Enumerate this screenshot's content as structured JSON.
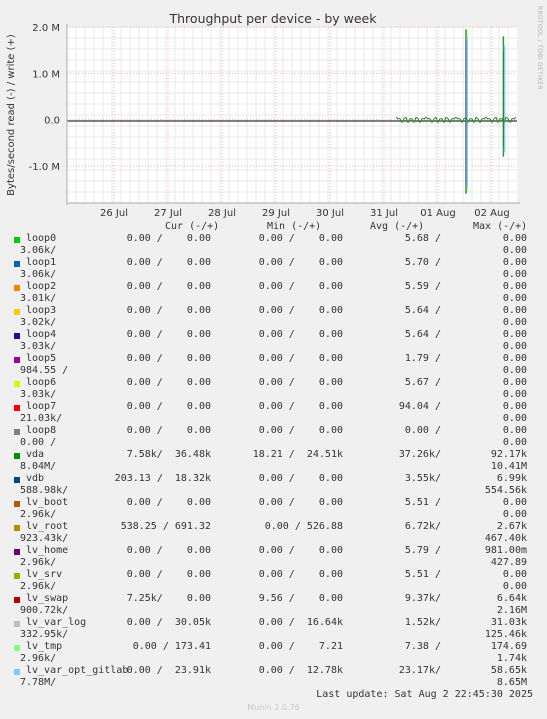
{
  "chart_data": {
    "type": "line",
    "title": "Throughput per device - by week",
    "ylabel": "Bytes/second read (-) / write (+)",
    "ylim": [
      -1800000,
      2000000
    ],
    "yticks": [
      "2.0 M",
      "1.0 M",
      "0.0",
      "-1.0 M"
    ],
    "xticks": [
      "26 Jul",
      "27 Jul",
      "28 Jul",
      "29 Jul",
      "30 Jul",
      "31 Jul",
      "01 Aug",
      "02 Aug"
    ],
    "grid": true,
    "series": [
      {
        "name": "vda",
        "color": "#00b300",
        "points": [
          [
            0.92,
            1800000
          ],
          [
            0.92,
            -800000
          ],
          [
            1.0,
            1950000
          ],
          [
            1.0,
            -1600000
          ]
        ]
      },
      {
        "name": "vdb",
        "color": "#0b5790",
        "points": [
          [
            0.92,
            1500000
          ],
          [
            0.92,
            -600000
          ],
          [
            1.0,
            1700000
          ],
          [
            1.0,
            -1400000
          ]
        ]
      },
      {
        "name": "lv_var_opt_gitlab",
        "color": "#8ecbf2",
        "points": [
          [
            0.92,
            1600000
          ],
          [
            0.92,
            -700000
          ],
          [
            1.0,
            1800000
          ],
          [
            1.0,
            -1500000
          ]
        ]
      }
    ]
  },
  "side_note": "RRDTOOL / TOBI OETIKER",
  "header": {
    "cur": "Cur (-/+)",
    "min": "Min (-/+)",
    "avg": "Avg (-/+)",
    "max": "Max (-/+)"
  },
  "legend": [
    {
      "name": "loop0",
      "color": "#00cc00",
      "cur": "0.00 /    0.00",
      "min": "0.00 /    0.00",
      "avg": "5.68 /",
      "max": "0.00",
      "l2l": "3.06k/",
      "l2r": "0.00"
    },
    {
      "name": "loop1",
      "color": "#0066b3",
      "cur": "0.00 /    0.00",
      "min": "0.00 /    0.00",
      "avg": "5.70 /",
      "max": "0.00",
      "l2l": "3.06k/",
      "l2r": "0.00"
    },
    {
      "name": "loop2",
      "color": "#ff8000",
      "cur": "0.00 /    0.00",
      "min": "0.00 /    0.00",
      "avg": "5.59 /",
      "max": "0.00",
      "l2l": "3.01k/",
      "l2r": "0.00"
    },
    {
      "name": "loop3",
      "color": "#ffcc00",
      "cur": "0.00 /    0.00",
      "min": "0.00 /    0.00",
      "avg": "5.64 /",
      "max": "0.00",
      "l2l": "3.02k/",
      "l2r": "0.00"
    },
    {
      "name": "loop4",
      "color": "#330099",
      "cur": "0.00 /    0.00",
      "min": "0.00 /    0.00",
      "avg": "5.64 /",
      "max": "0.00",
      "l2l": "3.03k/",
      "l2r": "0.00"
    },
    {
      "name": "loop5",
      "color": "#990099",
      "cur": "0.00 /    0.00",
      "min": "0.00 /    0.00",
      "avg": "1.79 /",
      "max": "0.00",
      "l2l": "984.55 /",
      "l2r": "0.00"
    },
    {
      "name": "loop6",
      "color": "#ccff00",
      "cur": "0.00 /    0.00",
      "min": "0.00 /    0.00",
      "avg": "5.67 /",
      "max": "0.00",
      "l2l": "3.03k/",
      "l2r": "0.00"
    },
    {
      "name": "loop7",
      "color": "#ff0000",
      "cur": "0.00 /    0.00",
      "min": "0.00 /    0.00",
      "avg": "94.04 /",
      "max": "0.00",
      "l2l": "21.03k/",
      "l2r": "0.00"
    },
    {
      "name": "loop8",
      "color": "#808080",
      "cur": "0.00 /    0.00",
      "min": "0.00 /    0.00",
      "avg": "0.00 /",
      "max": "0.00",
      "l2l": "0.00 /",
      "l2r": "0.00"
    },
    {
      "name": "vda",
      "color": "#008f00",
      "cur": "7.58k/  36.48k",
      "min": "18.21 /  24.51k",
      "avg": "37.26k/",
      "max": "92.17k",
      "l2l": "8.04M/",
      "l2r": "10.41M"
    },
    {
      "name": "vdb",
      "color": "#00487d",
      "cur": "203.13 /  18.32k",
      "min": "0.00 /    0.00",
      "avg": "3.55k/",
      "max": "6.99k",
      "l2l": "588.98k/",
      "l2r": "554.56k"
    },
    {
      "name": "lv_boot",
      "color": "#b35a00",
      "cur": "0.00 /    0.00",
      "min": "0.00 /    0.00",
      "avg": "5.51 /",
      "max": "0.00",
      "l2l": "2.96k/",
      "l2r": "0.00"
    },
    {
      "name": "lv_root",
      "color": "#b38f00",
      "cur": "538.25 / 691.32",
      "min": "0.00 / 526.88",
      "avg": "6.72k/",
      "max": "2.67k",
      "l2l": "923.43k/",
      "l2r": "467.40k"
    },
    {
      "name": "lv_home",
      "color": "#6b006b",
      "cur": "0.00 /    0.00",
      "min": "0.00 /    0.00",
      "avg": "5.79 /",
      "max": "981.00m",
      "l2l": "2.96k/",
      "l2r": "427.89"
    },
    {
      "name": "lv_srv",
      "color": "#8fb300",
      "cur": "0.00 /    0.00",
      "min": "0.00 /    0.00",
      "avg": "5.51 /",
      "max": "0.00",
      "l2l": "2.96k/",
      "l2r": "0.00"
    },
    {
      "name": "lv_swap",
      "color": "#b30000",
      "cur": "7.25k/    0.00",
      "min": "9.56 /    0.00",
      "avg": "9.37k/",
      "max": "6.64k",
      "l2l": "900.72k/",
      "l2r": "2.16M"
    },
    {
      "name": "lv_var_log",
      "color": "#bebebe",
      "cur": "0.00 /  30.05k",
      "min": "0.00 /  16.64k",
      "avg": "1.52k/",
      "max": "31.03k",
      "l2l": "332.95k/",
      "l2r": "125.46k"
    },
    {
      "name": "lv_tmp",
      "color": "#80ff80",
      "cur": "0.00 / 173.41",
      "min": "0.00 /    7.21",
      "avg": "7.38 /",
      "max": "174.69",
      "l2l": "2.96k/",
      "l2r": "1.74k"
    },
    {
      "name": "lv_var_opt_gitlab",
      "color": "#80c9ff",
      "cur": "0.00 /  23.91k",
      "min": "0.00 /  12.78k",
      "avg": "23.17k/",
      "max": "58.65k",
      "l2l": "7.78M/",
      "l2r": "8.65M"
    }
  ],
  "last_update": "Last update: Sat Aug  2 22:45:30 2025",
  "munin_version": "Munin 2.0.76"
}
